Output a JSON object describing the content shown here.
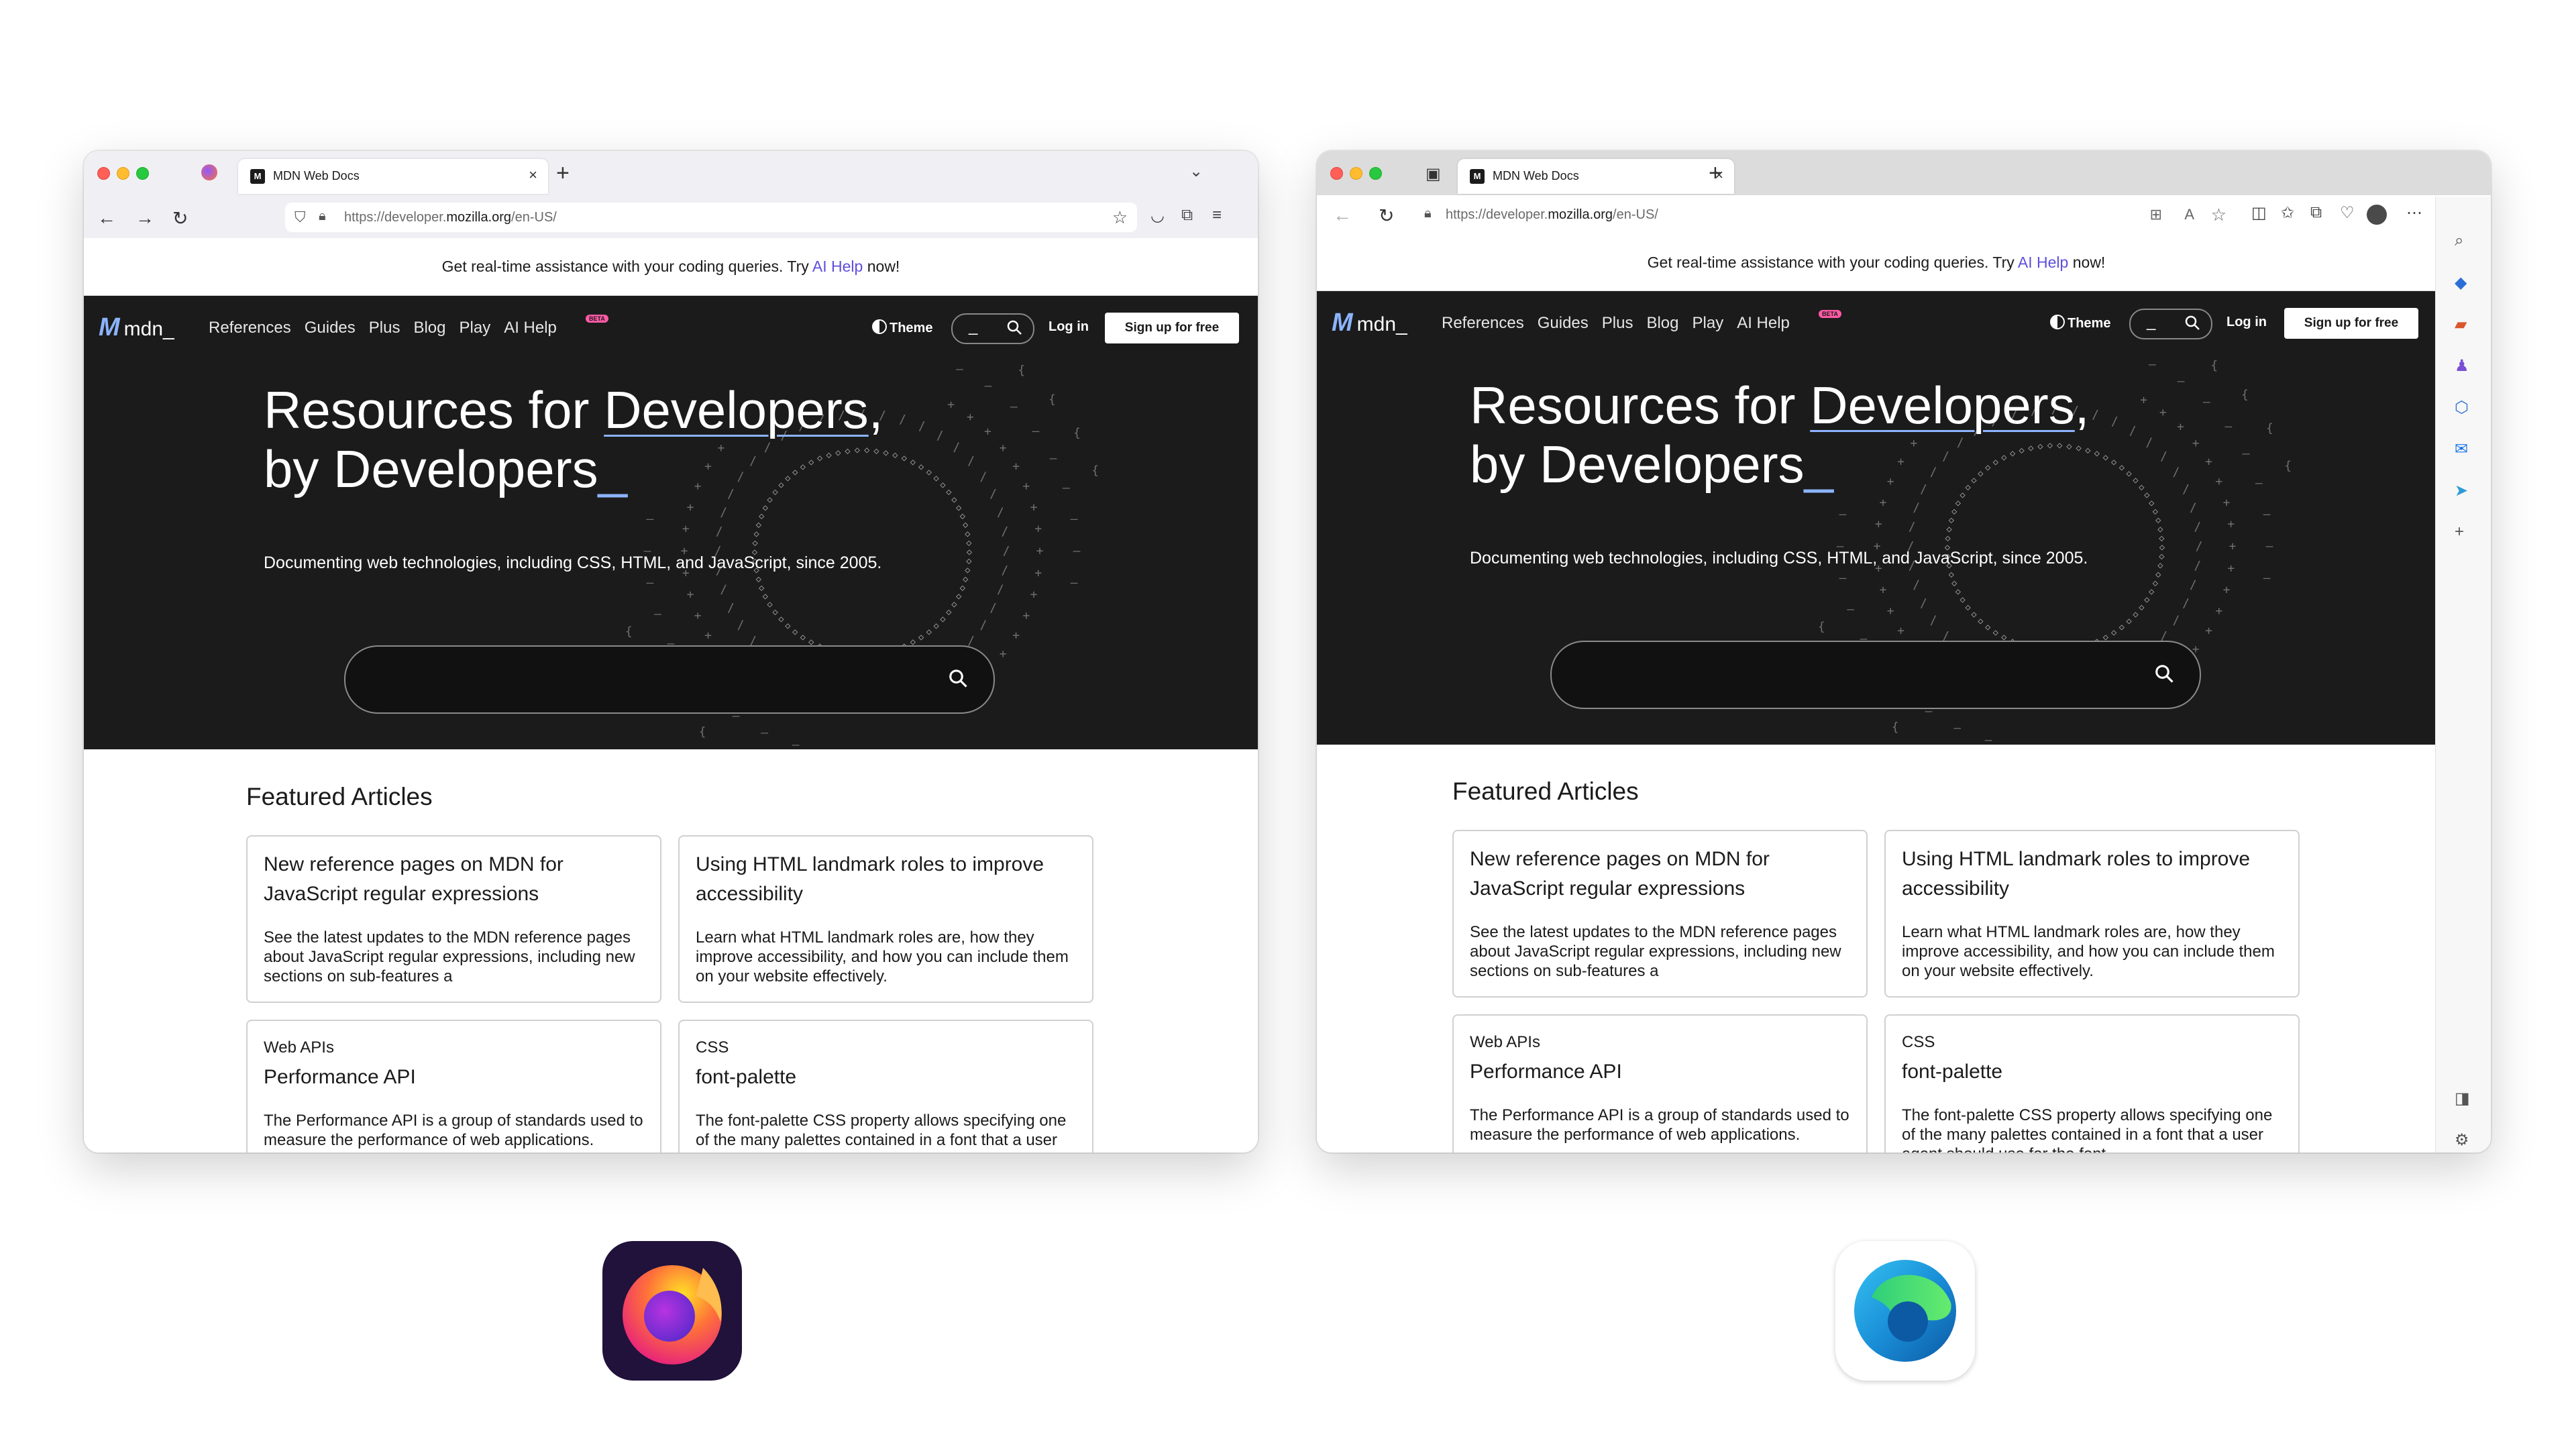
{
  "firefox": {
    "tab_title": "MDN Web Docs",
    "url_prefix": "https://developer.",
    "url_domain": "mozilla.org",
    "url_suffix": "/en-US/"
  },
  "edge": {
    "tab_title": "MDN Web Docs",
    "url_prefix": "https://developer.",
    "url_domain": "mozilla.org",
    "url_suffix": "/en-US/"
  },
  "page": {
    "banner_text": "Get real-time assistance with your coding queries. Try ",
    "banner_link": "AI Help",
    "banner_end": " now!",
    "logo_text": "mdn_",
    "nav": [
      "References",
      "Guides",
      "Plus",
      "Blog",
      "Play",
      "AI Help"
    ],
    "beta_badge": "BETA",
    "theme_label": "Theme",
    "navsearch_cursor": "_",
    "login_label": "Log in",
    "signup_label": "Sign up for free",
    "hero_line1_pre": "Resources for ",
    "hero_line1_link": "Developers",
    "hero_line1_post": ",",
    "hero_line2": "by Developers",
    "hero_cursor": "_",
    "hero_sub": "Documenting web technologies, including CSS, HTML, and JavaScript, since 2005.",
    "featured_heading": "Featured Articles",
    "cards": [
      {
        "kicker": "",
        "title": "New reference pages on MDN for JavaScript regular expressions",
        "desc": "See the latest updates to the MDN reference pages about JavaScript regular expressions, including new sections on sub-features a"
      },
      {
        "kicker": "",
        "title": "Using HTML landmark roles to improve accessibility",
        "desc": "Learn what HTML landmark roles are, how they improve accessibility, and how you can include them on your website effectively."
      },
      {
        "kicker": "Web APIs",
        "title": "Performance API",
        "desc": "The Performance API is a group of standards used to measure the performance of web applications."
      },
      {
        "kicker": "CSS",
        "title": "font-palette",
        "desc": "The font-palette CSS property allows specifying one of the many palettes contained in a font that a user agent should use for the font."
      }
    ]
  },
  "colors": {
    "accent": "#8cb4ff",
    "link": "#5e4fdb",
    "dark": "#1b1b1b",
    "beta": "#ff5aa5"
  },
  "icons": [
    "firefox-app-icon",
    "edge-app-icon",
    "search-icon",
    "back-icon",
    "forward-icon",
    "reload-icon",
    "shield-icon",
    "lock-icon",
    "bookmark-star-icon"
  ]
}
